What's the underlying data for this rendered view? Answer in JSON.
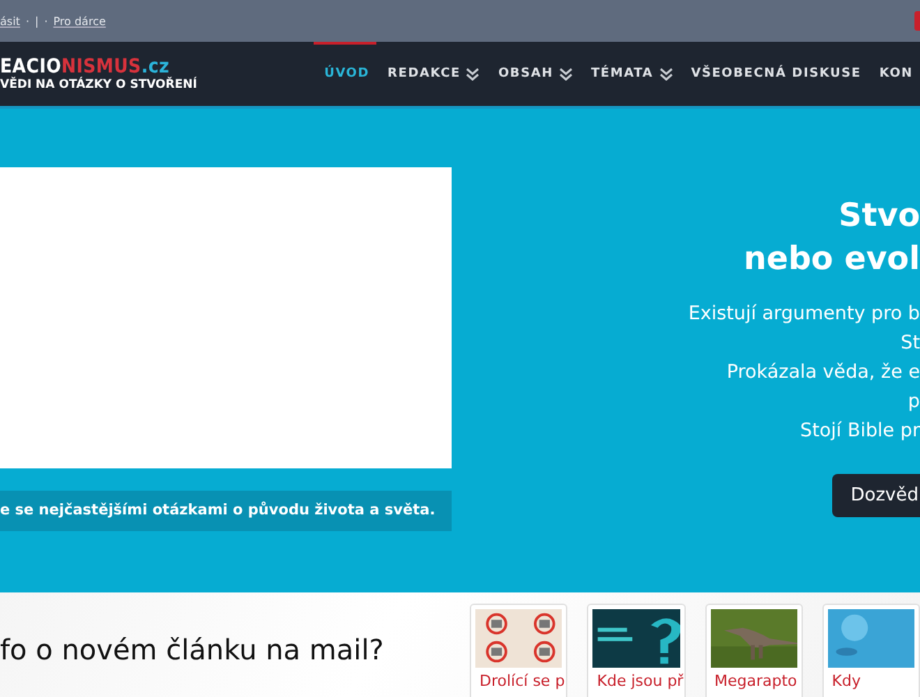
{
  "top_bar": {
    "items": [
      {
        "kind": "link",
        "text": "ásit"
      },
      {
        "kind": "separator",
        "text": "·"
      },
      {
        "kind": "separator",
        "text": "|"
      },
      {
        "kind": "separator",
        "text": "·"
      },
      {
        "kind": "link",
        "text": "Pro dárce"
      }
    ]
  },
  "header": {
    "logo": {
      "part_1": "EACIO",
      "part_2": "NISMUS",
      "part_3": ".cz",
      "tagline": "VĚDI NA OTÁZKY O STVOŘENÍ"
    },
    "nav": [
      {
        "label": "ÚVOD",
        "selected": true,
        "dropdown": false
      },
      {
        "label": "REDAKCE",
        "selected": false,
        "dropdown": true
      },
      {
        "label": "OBSAH",
        "selected": false,
        "dropdown": true
      },
      {
        "label": "TÉMATA",
        "selected": false,
        "dropdown": true
      },
      {
        "label": "VŠEOBECNÁ DISKUSE",
        "selected": false,
        "dropdown": false
      },
      {
        "label": "KON",
        "selected": false,
        "dropdown": false
      }
    ]
  },
  "hero": {
    "caption": "e se nejčastějšími otázkami o původu života a světa.",
    "title_lines": [
      "Stvo",
      "nebo evol"
    ],
    "text_lines": [
      "Existují argumenty pro b",
      "St",
      "Prokázala věda, že e",
      "p",
      "Stojí Bible pr"
    ],
    "button": "Dozvěd"
  },
  "newsletter": {
    "heading": "fo o novém článku na mail?"
  },
  "articles": [
    {
      "title": "Drolící se p"
    },
    {
      "title": "Kde jsou př"
    },
    {
      "title": "Megarapto"
    },
    {
      "title": "Kdy"
    }
  ]
}
